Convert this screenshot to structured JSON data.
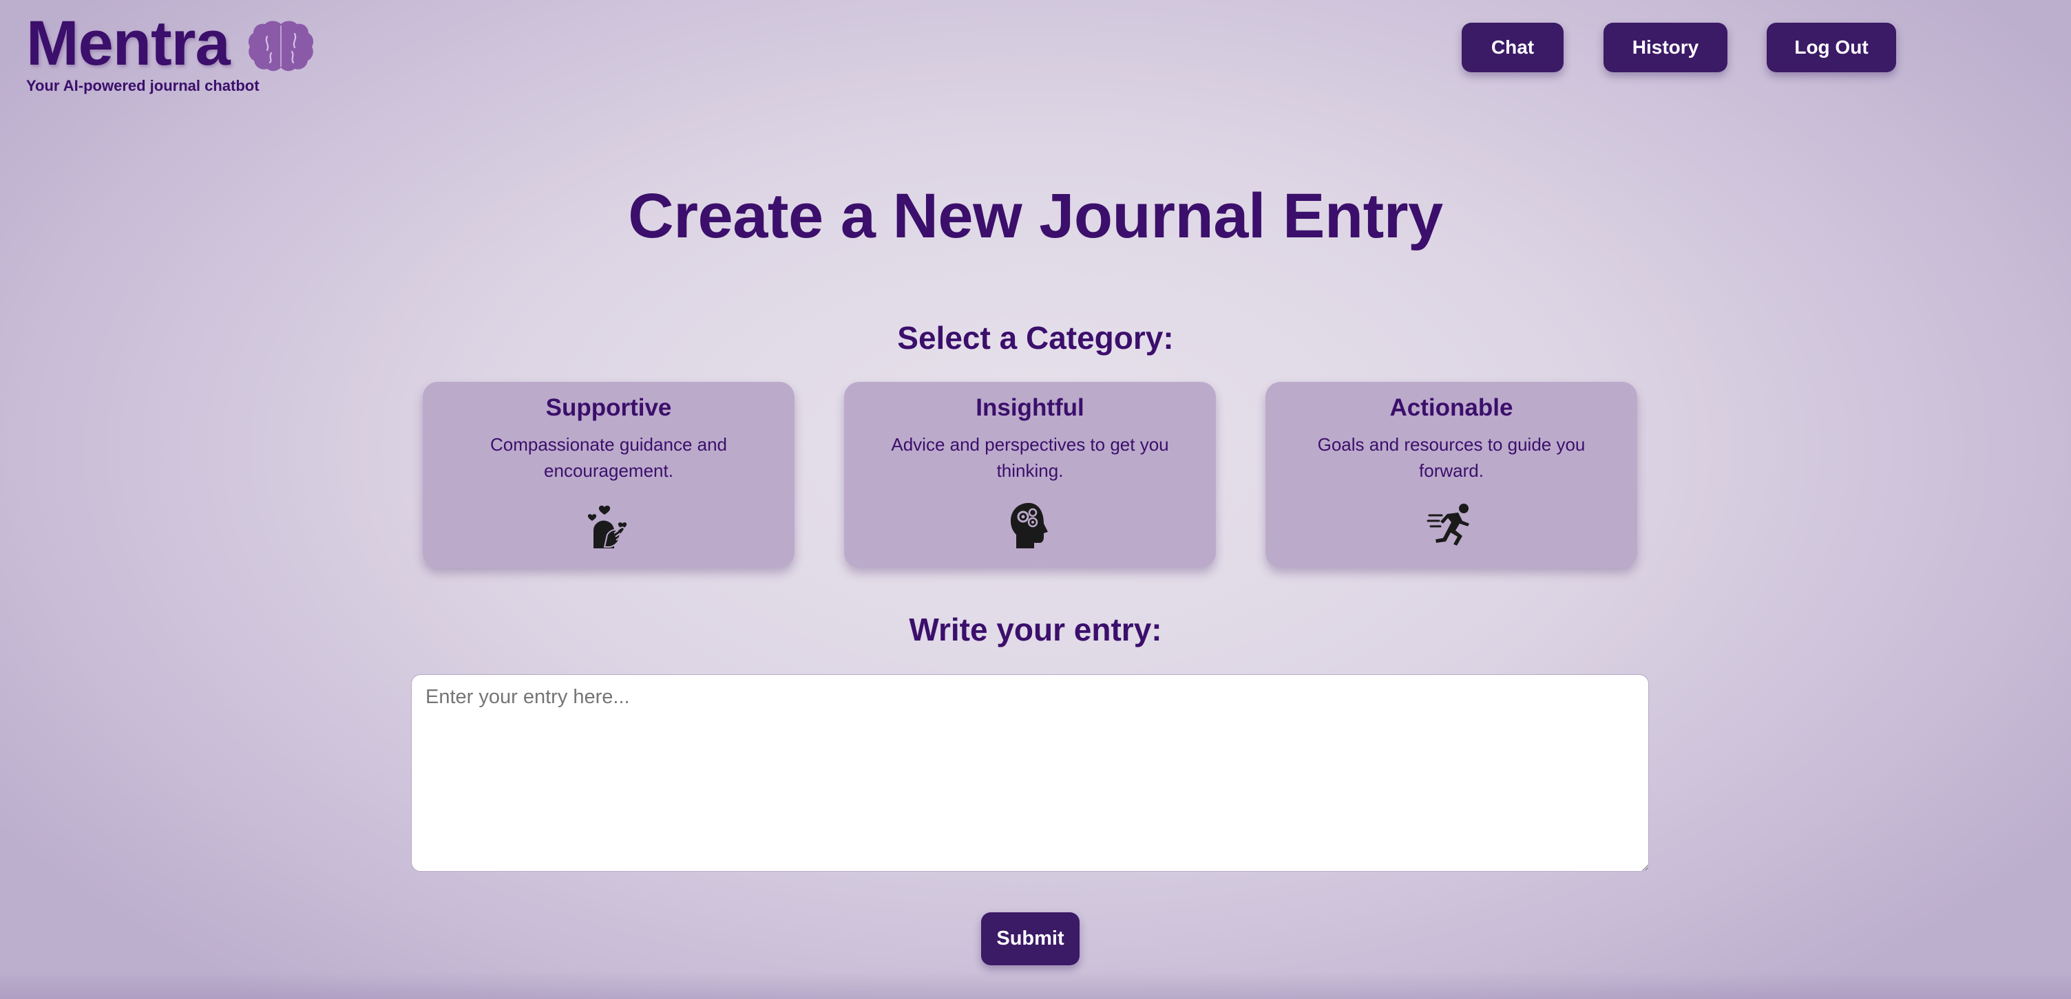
{
  "brand": {
    "name": "Mentra",
    "tagline": "Your AI-powered journal chatbot",
    "icon": "brain-icon"
  },
  "nav": {
    "chat": "Chat",
    "history": "History",
    "logout": "Log Out"
  },
  "page": {
    "title": "Create a New Journal Entry",
    "category_label": "Select a Category:",
    "entry_label": "Write your entry:"
  },
  "categories": [
    {
      "title": "Supportive",
      "description": "Compassionate guidance and encouragement.",
      "icon": "hearts-hand-icon"
    },
    {
      "title": "Insightful",
      "description": "Advice and perspectives to get you thinking.",
      "icon": "head-gears-icon"
    },
    {
      "title": "Actionable",
      "description": "Goals and resources to guide you forward.",
      "icon": "running-person-icon"
    }
  ],
  "entry": {
    "placeholder": "Enter your entry here...",
    "value": ""
  },
  "submit_label": "Submit",
  "colors": {
    "primary": "#3b0f6b",
    "button": "#3b1a66",
    "card": "#bcaacb",
    "brain": "#8a5aa8"
  }
}
